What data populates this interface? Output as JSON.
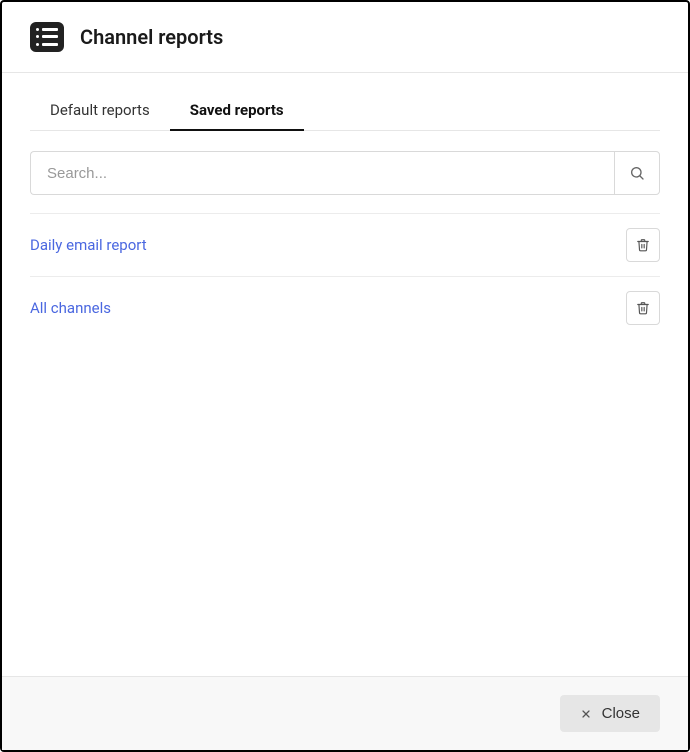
{
  "header": {
    "title": "Channel reports"
  },
  "tabs": {
    "default": {
      "label": "Default reports",
      "active": false
    },
    "saved": {
      "label": "Saved reports",
      "active": true
    }
  },
  "search": {
    "placeholder": "Search...",
    "value": ""
  },
  "reports": [
    {
      "name": "Daily email report"
    },
    {
      "name": "All channels"
    }
  ],
  "footer": {
    "close_label": "Close"
  }
}
